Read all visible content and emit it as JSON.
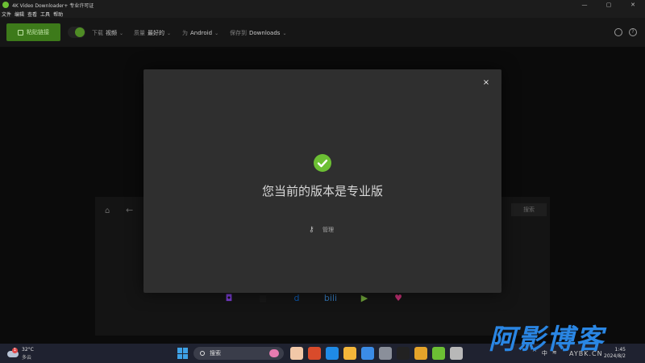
{
  "window": {
    "title": "4K Video Downloader+ 专业许可证",
    "minimize": "—",
    "maximize": "▢",
    "close": "✕"
  },
  "menu": [
    "文件",
    "编辑",
    "查看",
    "工具",
    "帮助"
  ],
  "toolbar": {
    "paste_label": "粘贴链接",
    "download_label": "下载",
    "download_value": "视频",
    "quality_label": "质量",
    "quality_value": "最好的",
    "format_label": "为",
    "format_value": "Android",
    "save_label": "保存到",
    "save_value": "Downloads"
  },
  "browser": {
    "search_button": "搜索",
    "sites": [
      {
        "name": "twitch",
        "glyph": "◘",
        "color": "#9146ff"
      },
      {
        "name": "vimeo",
        "glyph": "■",
        "color": "#1a1a1a"
      },
      {
        "name": "dailymotion",
        "glyph": "d",
        "color": "#0a6bd8"
      },
      {
        "name": "bilibili",
        "glyph": "bili",
        "color": "#3b8fe0"
      },
      {
        "name": "rumble",
        "glyph": "▶",
        "color": "#85c742"
      },
      {
        "name": "likee",
        "glyph": "♥",
        "color": "#f0388c"
      }
    ]
  },
  "modal": {
    "message": "您当前的版本是专业版",
    "manage_label": "管理",
    "close_icon": "×",
    "accent": "#6cbf34"
  },
  "taskbar": {
    "weather_badge": "1",
    "temperature": "32°C",
    "weather_desc": "多云",
    "search_placeholder": "搜索",
    "ime": "中",
    "time": "1:45",
    "date": "2024/8/2",
    "apps": [
      "#f1c8a8",
      "#d94b2b",
      "#1f8be6",
      "#f3b63a",
      "#3b8ce6",
      "#8a8f9a",
      "#222222",
      "#e4a32a",
      "#6cbf34",
      "#b8b8b8"
    ]
  },
  "watermark": {
    "main": "阿影博客",
    "sub": "AYBK.CN"
  }
}
